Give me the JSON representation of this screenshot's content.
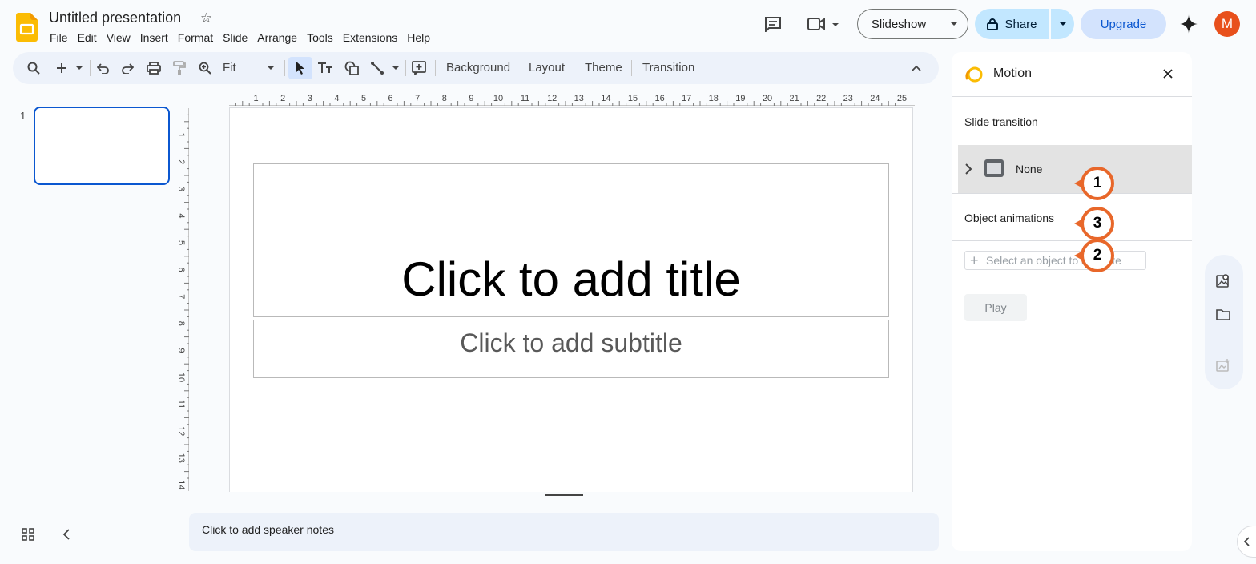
{
  "app": {
    "doc_title": "Untitled presentation",
    "menu": [
      "File",
      "Edit",
      "View",
      "Insert",
      "Format",
      "Slide",
      "Arrange",
      "Tools",
      "Extensions",
      "Help"
    ],
    "slideshow_label": "Slideshow",
    "share_label": "Share",
    "upgrade_label": "Upgrade",
    "avatar_initial": "M"
  },
  "toolbar": {
    "zoom_value": "Fit",
    "background_label": "Background",
    "layout_label": "Layout",
    "theme_label": "Theme",
    "transition_label": "Transition"
  },
  "filmstrip": {
    "slide_number": "1"
  },
  "ruler": {
    "h_ticks": [
      "1",
      "2",
      "3",
      "4",
      "5",
      "6",
      "7",
      "8",
      "9",
      "10",
      "11",
      "12",
      "13",
      "14",
      "15",
      "16",
      "17",
      "18",
      "19",
      "20",
      "21",
      "22",
      "23",
      "24",
      "25"
    ],
    "v_ticks": [
      "1",
      "2",
      "3",
      "4",
      "5",
      "6",
      "7",
      "8",
      "9",
      "10",
      "11",
      "12",
      "13",
      "14"
    ]
  },
  "slide": {
    "title_placeholder": "Click to add title",
    "subtitle_placeholder": "Click to add subtitle"
  },
  "notes": {
    "placeholder": "Click to add speaker notes"
  },
  "motion_panel": {
    "title": "Motion",
    "slide_transition_label": "Slide transition",
    "transition_value": "None",
    "object_animations_label": "Object animations",
    "animate_button": "Select an object to animate",
    "play_label": "Play"
  },
  "callouts": [
    "1",
    "3",
    "2"
  ],
  "colors": {
    "accent": "#0b57d0",
    "share_bg": "#c2e7ff",
    "upgrade_bg": "#d3e3fd",
    "callout": "#e8672a",
    "avatar_bg": "#e8501c"
  }
}
